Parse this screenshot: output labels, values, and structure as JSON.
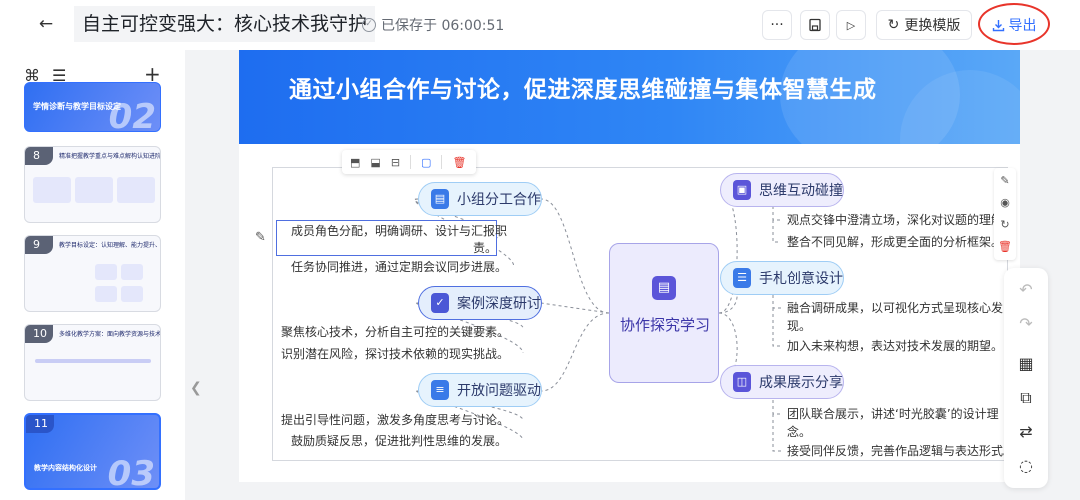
{
  "header": {
    "back_icon": "arrow-left-icon",
    "title": "自主可控变强大：核心技术我守护",
    "save_status": "已保存于 06:00:51",
    "more_icon": "more-icon",
    "save_icon": "save-icon",
    "play_icon": "play-icon",
    "template_label": "更换模版",
    "export_label": "导出",
    "export_highlight_color": "#e8342a"
  },
  "sidebar": {
    "thumbnails": [
      {
        "num": "",
        "text": "学情诊断与教学目标设定",
        "big": "02",
        "style": "blue"
      },
      {
        "num": "8",
        "text": "精准把握教学重点与难点解构认知进阶",
        "style": "light"
      },
      {
        "num": "9",
        "text": "教学目标设定：认知理解、能力提升、情感态度与价值观",
        "style": "light"
      },
      {
        "num": "10",
        "text": "多维化教学方案：面向教学资源与技术应用",
        "style": "light"
      },
      {
        "num": "11",
        "text": "教学内容结构化设计",
        "big": "03",
        "style": "blue"
      }
    ]
  },
  "slide": {
    "title": "通过小组合作与讨论，促进深度思维碰撞与集体智慧生成",
    "header_color": "#1e6df0",
    "center": {
      "label": "协作探究学习",
      "icon": "document-icon"
    },
    "left_branches": [
      {
        "label": "小组分工合作",
        "icon": "document-icon",
        "leaves": [
          "成员角色分配，明确调研、设计与汇报职",
          "责。",
          "任务协同推进，通过定期会议同步进展。"
        ]
      },
      {
        "label": "案例深度研讨",
        "icon": "checkbox-icon",
        "leaves": [
          "聚焦核心技术，分析自主可控的关键要素。",
          "识别潜在风险，探讨技术依赖的现实挑战。"
        ]
      },
      {
        "label": "开放问题驱动",
        "icon": "database-icon",
        "leaves": [
          "提出引导性问题，激发多角度思考与讨论。",
          "鼓励质疑反思，促进批判性思维的发展。"
        ]
      }
    ],
    "right_branches": [
      {
        "label": "思维互动碰撞",
        "icon": "id-card-icon",
        "leaves": [
          "观点交锋中澄清立场，深化对议题的理解。",
          "整合不同见解，形成更全面的分析框架。"
        ]
      },
      {
        "label": "手札创意设计",
        "icon": "list-icon",
        "leaves": [
          "融合调研成果，以可视化方式呈现核心发",
          "现。",
          "加入未来构想，表达对技术发展的期望。"
        ]
      },
      {
        "label": "成果展示分享",
        "icon": "box-icon",
        "leaves": [
          "团队联合展示，讲述‘时光胶囊’的设计理",
          "念。",
          "接受同伴反馈，完善作品逻辑与表达形式。"
        ]
      }
    ]
  }
}
